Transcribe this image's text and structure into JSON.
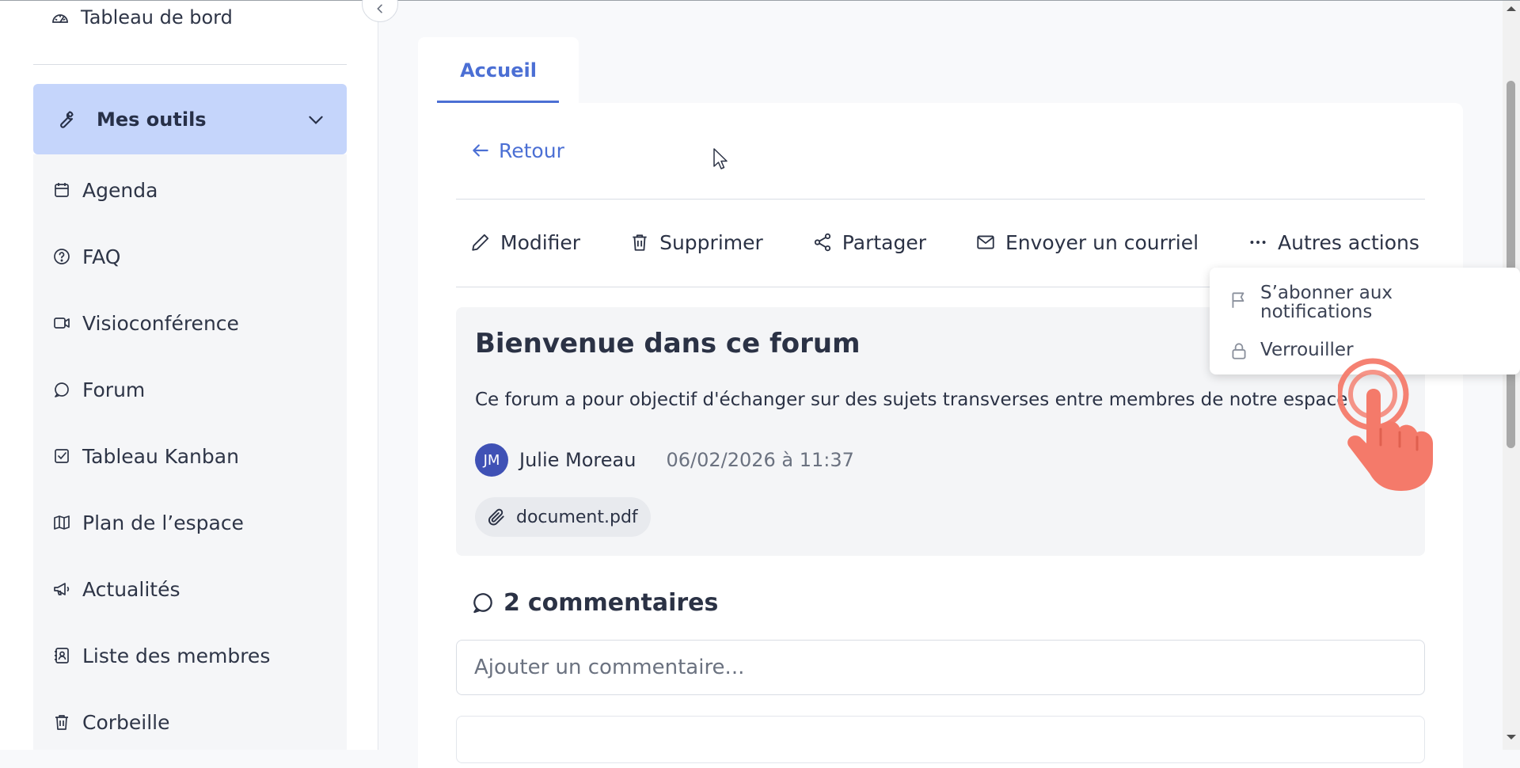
{
  "sidebar": {
    "dashboard": "Tableau de bord",
    "group_label": "Mes outils",
    "items": [
      {
        "label": "Agenda",
        "icon": "calendar-icon"
      },
      {
        "label": "FAQ",
        "icon": "help-circle-icon"
      },
      {
        "label": "Visioconférence",
        "icon": "video-icon"
      },
      {
        "label": "Forum",
        "icon": "chat-bubble-icon"
      },
      {
        "label": "Tableau Kanban",
        "icon": "checkbox-icon"
      },
      {
        "label": "Plan de l’espace",
        "icon": "map-icon"
      },
      {
        "label": "Actualités",
        "icon": "megaphone-icon"
      },
      {
        "label": "Liste des membres",
        "icon": "contact-book-icon"
      },
      {
        "label": "Corbeille",
        "icon": "trash-icon"
      }
    ]
  },
  "tabs": [
    {
      "label": "Accueil",
      "active": true
    }
  ],
  "back_label": "Retour",
  "actions": {
    "edit": "Modifier",
    "delete": "Supprimer",
    "share": "Partager",
    "email": "Envoyer un courriel",
    "more": "Autres actions"
  },
  "dropdown": {
    "subscribe_line1": "S’abonner aux",
    "subscribe_line2": "notifications",
    "lock": "Verrouiller"
  },
  "post": {
    "title": "Bienvenue dans ce forum",
    "body": "Ce forum a pour objectif d'échanger sur des sujets transverses entre membres de notre espace",
    "author_initials": "JM",
    "author_name": "Julie Moreau",
    "date": "06/02/2026 à 11:37",
    "attachment": "document.pdf"
  },
  "comments": {
    "count": "2",
    "label": "commentaires",
    "placeholder": "Ajouter un commentaire..."
  },
  "colors": {
    "accent": "#4b6fd4",
    "group_bg": "#c5d5fb",
    "avatar_bg": "#3f51b5",
    "hand": "#f47a6a"
  }
}
